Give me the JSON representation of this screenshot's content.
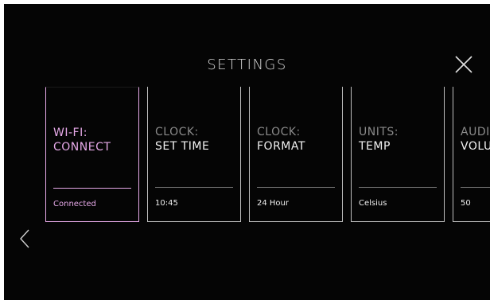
{
  "header": {
    "title": "SETTINGS",
    "close_icon": "close-x-icon"
  },
  "navigation": {
    "prev_icon": "chevron-left-icon"
  },
  "colors": {
    "accent": "#e6a9e8",
    "background": "#050505",
    "card_border": "#bdbdbd"
  },
  "cards": [
    {
      "label": "WI-FI:",
      "value": "CONNECT",
      "status": "Connected",
      "selected": true
    },
    {
      "label": "CLOCK:",
      "value": "SET TIME",
      "status": "10:45",
      "selected": false
    },
    {
      "label": "CLOCK:",
      "value": "FORMAT",
      "status": "24 Hour",
      "selected": false
    },
    {
      "label": "UNITS:",
      "value": "TEMP",
      "status": "Celsius",
      "selected": false
    },
    {
      "label": "AUDIO:",
      "value": "VOLUME",
      "status": "50",
      "selected": false
    }
  ]
}
